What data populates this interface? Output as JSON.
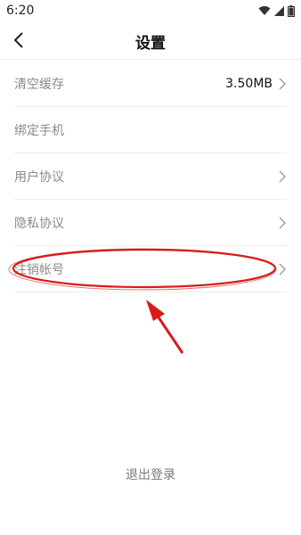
{
  "status": {
    "time": "6:20"
  },
  "header": {
    "title": "设置"
  },
  "settings": {
    "items": [
      {
        "label": "清空缓存",
        "value": "3.50MB",
        "has_chevron": true
      },
      {
        "label": "绑定手机",
        "value": "",
        "has_chevron": false
      },
      {
        "label": "用户协议",
        "value": "",
        "has_chevron": true
      },
      {
        "label": "隐私协议",
        "value": "",
        "has_chevron": true
      },
      {
        "label": "注销帐号",
        "value": "",
        "has_chevron": true
      }
    ]
  },
  "footer": {
    "logout_label": "退出登录"
  },
  "colors": {
    "annotation": "#d91a1a",
    "label": "#8a8a8a",
    "divider": "#ececec"
  }
}
